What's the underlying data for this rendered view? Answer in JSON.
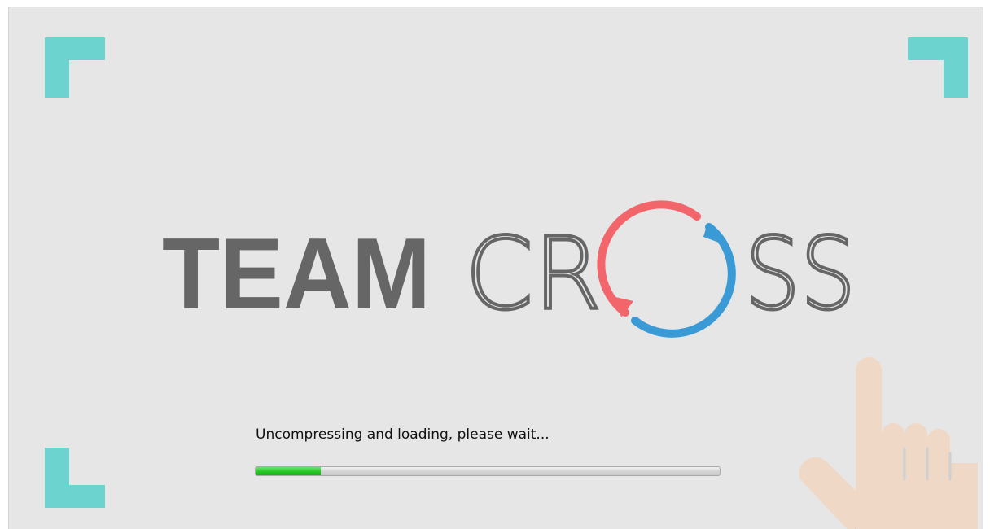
{
  "splash": {
    "logo": {
      "word_team": "TEAM",
      "word_cross_prefix": "CR",
      "word_cross_suffix": "SS",
      "colors": {
        "text_dark": "#666666",
        "arrow_red": "#f2666b",
        "arrow_blue": "#3a9ad6"
      }
    },
    "status_text": "Uncompressing and loading, please wait...",
    "progress": {
      "fraction": 0.14,
      "fill_color": "#27c827"
    },
    "corner_color": "#6dd3cf",
    "hand_color": "#efd8c6",
    "hand_shadow_color": "#cfcfcf"
  }
}
